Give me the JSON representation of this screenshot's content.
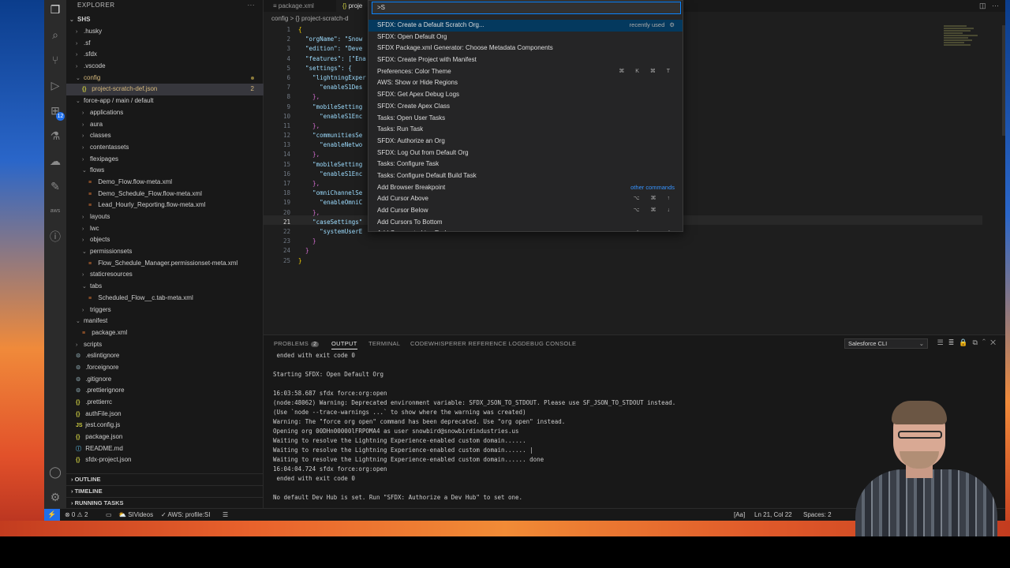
{
  "explorer": {
    "title": "EXPLORER",
    "more": "···",
    "root": "SHS",
    "tree": [
      {
        "label": ".husky",
        "indent": 1,
        "kind": "folder",
        "open": false
      },
      {
        "label": ".sf",
        "indent": 1,
        "kind": "folder",
        "open": false
      },
      {
        "label": ".sfdx",
        "indent": 1,
        "kind": "folder",
        "open": false
      },
      {
        "label": ".vscode",
        "indent": 1,
        "kind": "folder",
        "open": false
      },
      {
        "label": "config",
        "indent": 1,
        "kind": "folder",
        "open": true,
        "modified": true
      },
      {
        "label": "project-scratch-def.json",
        "indent": 2,
        "kind": "json",
        "selected": true,
        "count": "2",
        "modified": true
      },
      {
        "label": "force-app / main / default",
        "indent": 1,
        "kind": "folder",
        "open": true
      },
      {
        "label": "applications",
        "indent": 2,
        "kind": "folder",
        "open": false
      },
      {
        "label": "aura",
        "indent": 2,
        "kind": "folder",
        "open": false
      },
      {
        "label": "classes",
        "indent": 2,
        "kind": "folder",
        "open": false
      },
      {
        "label": "contentassets",
        "indent": 2,
        "kind": "folder",
        "open": false
      },
      {
        "label": "flexipages",
        "indent": 2,
        "kind": "folder",
        "open": false
      },
      {
        "label": "flows",
        "indent": 2,
        "kind": "folder",
        "open": true
      },
      {
        "label": "Demo_Flow.flow-meta.xml",
        "indent": 3,
        "kind": "xml"
      },
      {
        "label": "Demo_Schedule_Flow.flow-meta.xml",
        "indent": 3,
        "kind": "xml"
      },
      {
        "label": "Lead_Hourly_Reporting.flow-meta.xml",
        "indent": 3,
        "kind": "xml"
      },
      {
        "label": "layouts",
        "indent": 2,
        "kind": "folder",
        "open": false
      },
      {
        "label": "lwc",
        "indent": 2,
        "kind": "folder",
        "open": false
      },
      {
        "label": "objects",
        "indent": 2,
        "kind": "folder",
        "open": false
      },
      {
        "label": "permissionsets",
        "indent": 2,
        "kind": "folder",
        "open": true
      },
      {
        "label": "Flow_Schedule_Manager.permissionset-meta.xml",
        "indent": 3,
        "kind": "xml"
      },
      {
        "label": "staticresources",
        "indent": 2,
        "kind": "folder",
        "open": false
      },
      {
        "label": "tabs",
        "indent": 2,
        "kind": "folder",
        "open": true
      },
      {
        "label": "Scheduled_Flow__c.tab-meta.xml",
        "indent": 3,
        "kind": "xml"
      },
      {
        "label": "triggers",
        "indent": 2,
        "kind": "folder",
        "open": false
      },
      {
        "label": "manifest",
        "indent": 1,
        "kind": "folder",
        "open": true
      },
      {
        "label": "package.xml",
        "indent": 2,
        "kind": "xml"
      },
      {
        "label": "scripts",
        "indent": 1,
        "kind": "folder",
        "open": false
      },
      {
        "label": ".eslintignore",
        "indent": 1,
        "kind": "dot"
      },
      {
        "label": ".forceignore",
        "indent": 1,
        "kind": "dot"
      },
      {
        "label": ".gitignore",
        "indent": 1,
        "kind": "dot"
      },
      {
        "label": ".prettierignore",
        "indent": 1,
        "kind": "dot"
      },
      {
        "label": ".prettierrc",
        "indent": 1,
        "kind": "json"
      },
      {
        "label": "authFile.json",
        "indent": 1,
        "kind": "json"
      },
      {
        "label": "jest.config.js",
        "indent": 1,
        "kind": "js"
      },
      {
        "label": "package.json",
        "indent": 1,
        "kind": "json"
      },
      {
        "label": "README.md",
        "indent": 1,
        "kind": "md"
      },
      {
        "label": "sfdx-project.json",
        "indent": 1,
        "kind": "json"
      }
    ],
    "sections": [
      "OUTLINE",
      "TIMELINE",
      "RUNNING TASKS"
    ]
  },
  "editor": {
    "tabs": [
      {
        "label": "package.xml",
        "icon": "≡",
        "active": false
      },
      {
        "label": "proje",
        "icon": "{}",
        "active": true
      }
    ],
    "breadcrumb": "config > {} project-scratch-d",
    "line_numbers": [
      "1",
      "2",
      "3",
      "4",
      "5",
      "6",
      "7",
      "8",
      "9",
      "10",
      "11",
      "12",
      "13",
      "14",
      "15",
      "16",
      "17",
      "18",
      "19",
      "20",
      "21",
      "22",
      "23",
      "24",
      "25"
    ],
    "current_line": "21",
    "code_lines": [
      "{",
      "  \"orgName\": \"Snow",
      "  \"edition\": \"Deve",
      "  \"features\": [\"Ena",
      "  \"settings\": {",
      "    \"lightningExper",
      "      \"enableS1Des",
      "    },",
      "    \"mobileSetting",
      "      \"enableS1Enc",
      "    },",
      "    \"communitiesSe",
      "      \"enableNetwo",
      "    },",
      "    \"mobileSetting",
      "      \"enableS1Enc",
      "    },",
      "    \"omniChannelSe",
      "      \"enableOmniC",
      "    },",
      "    \"caseSettings\"",
      "      \"systemUserE",
      "    }",
      "  }",
      "}"
    ]
  },
  "palette": {
    "query": ">S",
    "items": [
      {
        "label": "SFDX: Create a Default Scratch Org...",
        "meta": "recently used",
        "meta_icon": "⚙"
      },
      {
        "label": "SFDX: Open Default Org"
      },
      {
        "label": "SFDX Package.xml Generator: Choose Metadata Components"
      },
      {
        "label": "SFDX: Create Project with Manifest"
      },
      {
        "label": "Preferences: Color Theme",
        "keys": "⌘ K ⌘ T"
      },
      {
        "label": "AWS: Show or Hide Regions"
      },
      {
        "label": "SFDX: Get Apex Debug Logs"
      },
      {
        "label": "SFDX: Create Apex Class"
      },
      {
        "label": "Tasks: Open User Tasks"
      },
      {
        "label": "Tasks: Run Task"
      },
      {
        "label": "SFDX: Authorize an Org"
      },
      {
        "label": "SFDX: Log Out from Default Org"
      },
      {
        "label": "Tasks: Configure Task"
      },
      {
        "label": "Tasks: Configure Default Build Task"
      },
      {
        "label": "Add Browser Breakpoint",
        "meta": "other commands",
        "meta_link": true
      },
      {
        "label": "Add Cursor Above",
        "keys": "⌥ ⌘ ↑"
      },
      {
        "label": "Add Cursor Below",
        "keys": "⌥ ⌘ ↓"
      },
      {
        "label": "Add Cursors To Bottom"
      },
      {
        "label": "Add Cursors to Line Ends",
        "keys": "⇧ ⌥ I"
      }
    ]
  },
  "panel": {
    "tabs": [
      {
        "label": "PROBLEMS",
        "badge": "2"
      },
      {
        "label": "OUTPUT",
        "active": true
      },
      {
        "label": "TERMINAL"
      },
      {
        "label": "CODEWHISPERER REFERENCE LOG"
      },
      {
        "label": "DEBUG CONSOLE"
      }
    ],
    "channel": "Salesforce CLI",
    "output": [
      " ended with exit code 0",
      "",
      "Starting SFDX: Open Default Org",
      "",
      "16:03:58.687 sfdx force:org:open",
      "(node:48062) Warning: Deprecated environment variable: SFDX_JSON_TO_STDOUT. Please use SF_JSON_TO_STDOUT instead.",
      "(Use `node --trace-warnings ...` to show where the warning was created)",
      "Warning: The \"force org open\" command has been deprecated. Use \"org open\" instead.",
      "Opening org 00DHn00000lFRPOMA4 as user snowbird@snowbirdindustries.us",
      "Waiting to resolve the Lightning Experience-enabled custom domain......",
      "Waiting to resolve the Lightning Experience-enabled custom domain...... |",
      "Waiting to resolve the Lightning Experience-enabled custom domain...... done",
      "16:04:04.724 sfdx force:org:open",
      " ended with exit code 0",
      "",
      "No default Dev Hub is set. Run \"SFDX: Authorize a Dev Hub\" to set one."
    ]
  },
  "status": {
    "problems": "⊗ 0 ⚠ 2",
    "folder": "SIVideos",
    "aws": "AWS: profile:SI",
    "aa": "[Aa]",
    "position": "Ln 21, Col 22",
    "spaces": "Spaces: 2"
  },
  "colors": {
    "accent": "#1f6feb",
    "focus": "#04395e",
    "link": "#3794ff"
  }
}
